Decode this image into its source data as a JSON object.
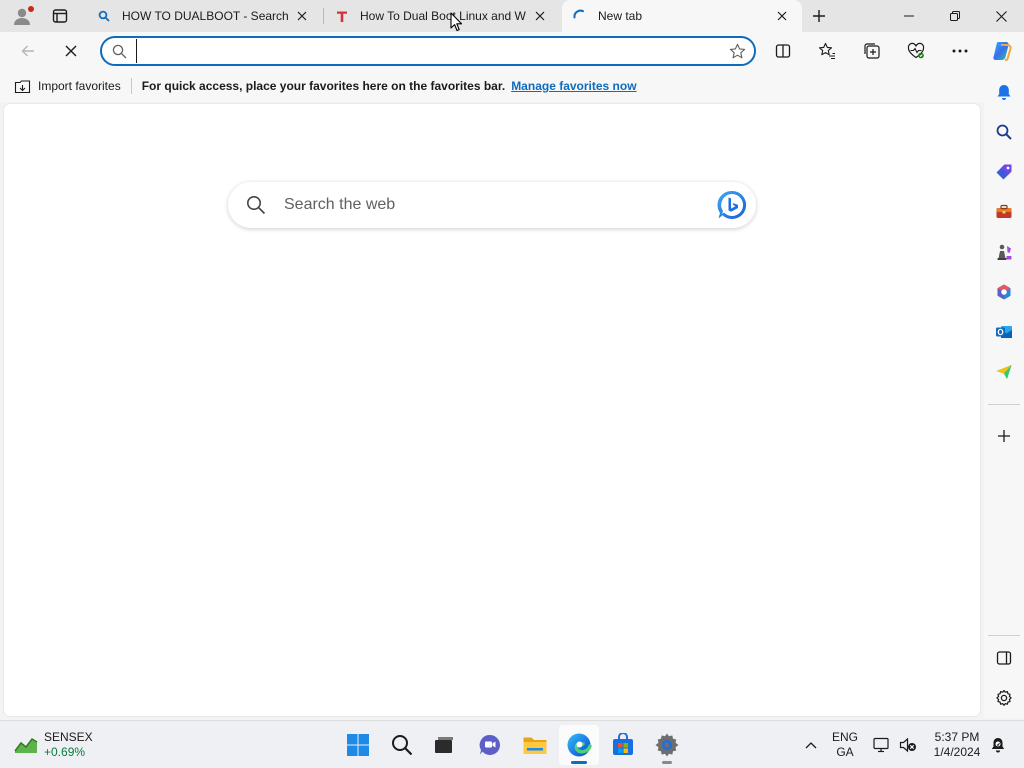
{
  "tabs": [
    {
      "title": "HOW TO DUALBOOT - Search",
      "close_label": "×"
    },
    {
      "title": "How To Dual Boot Linux and Windows",
      "close_label": "×"
    },
    {
      "title": "New tab",
      "close_label": "×"
    }
  ],
  "address_bar": {
    "value": "",
    "placeholder": ""
  },
  "favorites_bar": {
    "import_label": "Import favorites",
    "message": "For quick access, place your favorites here on the favorites bar.",
    "manage_link": "Manage favorites now"
  },
  "new_tab": {
    "search_placeholder": "Search the web"
  },
  "taskbar": {
    "widget": {
      "name": "SENSEX",
      "value": "+0.69%"
    },
    "language": {
      "line1": "ENG",
      "line2": "GA"
    },
    "clock": {
      "time": "5:37 PM",
      "date": "1/4/2024"
    }
  },
  "colors": {
    "accent": "#0f6cbd",
    "tab_strip": "#e5e5e5",
    "toolbar": "#f7f7f7",
    "stock_up": "#0b7a3b"
  },
  "icons": {
    "sidebar": [
      "bell-icon",
      "search-icon",
      "shopping-tag-icon",
      "toolbox-icon",
      "games-icon",
      "office-icon",
      "outlook-icon",
      "send-icon",
      "add-icon",
      "split-screen-icon",
      "settings-icon"
    ]
  }
}
